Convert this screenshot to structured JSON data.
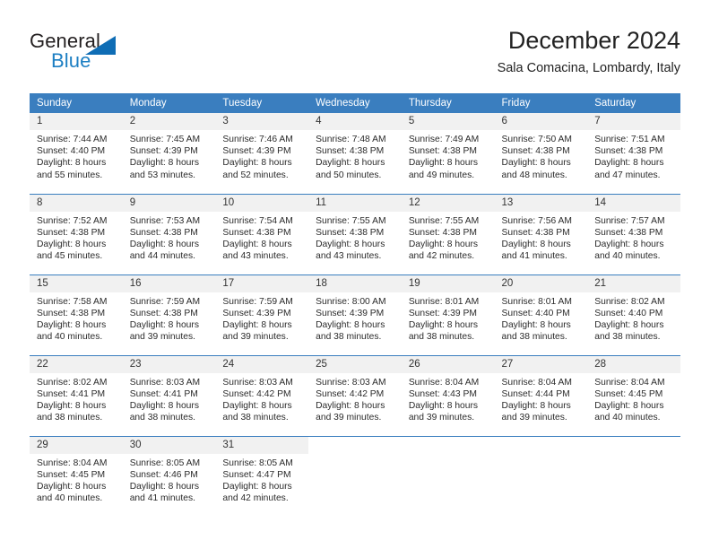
{
  "brand": {
    "name_part1": "General",
    "name_part2": "Blue",
    "triangle_color": "#0f6db5",
    "blue_text_color": "#1d7fc3"
  },
  "header": {
    "title": "December 2024",
    "subtitle": "Sala Comacina, Lombardy, Italy"
  },
  "theme": {
    "header_bg": "#3a7ebf",
    "daynum_bg": "#f1f1f1",
    "grid_line": "#3a7ebf",
    "text": "#222222"
  },
  "calendar": {
    "weekday_headers": [
      "Sunday",
      "Monday",
      "Tuesday",
      "Wednesday",
      "Thursday",
      "Friday",
      "Saturday"
    ],
    "weeks": [
      [
        {
          "day": "1",
          "sunrise": "Sunrise: 7:44 AM",
          "sunset": "Sunset: 4:40 PM",
          "daylight_line1": "Daylight: 8 hours",
          "daylight_line2": "and 55 minutes."
        },
        {
          "day": "2",
          "sunrise": "Sunrise: 7:45 AM",
          "sunset": "Sunset: 4:39 PM",
          "daylight_line1": "Daylight: 8 hours",
          "daylight_line2": "and 53 minutes."
        },
        {
          "day": "3",
          "sunrise": "Sunrise: 7:46 AM",
          "sunset": "Sunset: 4:39 PM",
          "daylight_line1": "Daylight: 8 hours",
          "daylight_line2": "and 52 minutes."
        },
        {
          "day": "4",
          "sunrise": "Sunrise: 7:48 AM",
          "sunset": "Sunset: 4:38 PM",
          "daylight_line1": "Daylight: 8 hours",
          "daylight_line2": "and 50 minutes."
        },
        {
          "day": "5",
          "sunrise": "Sunrise: 7:49 AM",
          "sunset": "Sunset: 4:38 PM",
          "daylight_line1": "Daylight: 8 hours",
          "daylight_line2": "and 49 minutes."
        },
        {
          "day": "6",
          "sunrise": "Sunrise: 7:50 AM",
          "sunset": "Sunset: 4:38 PM",
          "daylight_line1": "Daylight: 8 hours",
          "daylight_line2": "and 48 minutes."
        },
        {
          "day": "7",
          "sunrise": "Sunrise: 7:51 AM",
          "sunset": "Sunset: 4:38 PM",
          "daylight_line1": "Daylight: 8 hours",
          "daylight_line2": "and 47 minutes."
        }
      ],
      [
        {
          "day": "8",
          "sunrise": "Sunrise: 7:52 AM",
          "sunset": "Sunset: 4:38 PM",
          "daylight_line1": "Daylight: 8 hours",
          "daylight_line2": "and 45 minutes."
        },
        {
          "day": "9",
          "sunrise": "Sunrise: 7:53 AM",
          "sunset": "Sunset: 4:38 PM",
          "daylight_line1": "Daylight: 8 hours",
          "daylight_line2": "and 44 minutes."
        },
        {
          "day": "10",
          "sunrise": "Sunrise: 7:54 AM",
          "sunset": "Sunset: 4:38 PM",
          "daylight_line1": "Daylight: 8 hours",
          "daylight_line2": "and 43 minutes."
        },
        {
          "day": "11",
          "sunrise": "Sunrise: 7:55 AM",
          "sunset": "Sunset: 4:38 PM",
          "daylight_line1": "Daylight: 8 hours",
          "daylight_line2": "and 43 minutes."
        },
        {
          "day": "12",
          "sunrise": "Sunrise: 7:55 AM",
          "sunset": "Sunset: 4:38 PM",
          "daylight_line1": "Daylight: 8 hours",
          "daylight_line2": "and 42 minutes."
        },
        {
          "day": "13",
          "sunrise": "Sunrise: 7:56 AM",
          "sunset": "Sunset: 4:38 PM",
          "daylight_line1": "Daylight: 8 hours",
          "daylight_line2": "and 41 minutes."
        },
        {
          "day": "14",
          "sunrise": "Sunrise: 7:57 AM",
          "sunset": "Sunset: 4:38 PM",
          "daylight_line1": "Daylight: 8 hours",
          "daylight_line2": "and 40 minutes."
        }
      ],
      [
        {
          "day": "15",
          "sunrise": "Sunrise: 7:58 AM",
          "sunset": "Sunset: 4:38 PM",
          "daylight_line1": "Daylight: 8 hours",
          "daylight_line2": "and 40 minutes."
        },
        {
          "day": "16",
          "sunrise": "Sunrise: 7:59 AM",
          "sunset": "Sunset: 4:38 PM",
          "daylight_line1": "Daylight: 8 hours",
          "daylight_line2": "and 39 minutes."
        },
        {
          "day": "17",
          "sunrise": "Sunrise: 7:59 AM",
          "sunset": "Sunset: 4:39 PM",
          "daylight_line1": "Daylight: 8 hours",
          "daylight_line2": "and 39 minutes."
        },
        {
          "day": "18",
          "sunrise": "Sunrise: 8:00 AM",
          "sunset": "Sunset: 4:39 PM",
          "daylight_line1": "Daylight: 8 hours",
          "daylight_line2": "and 38 minutes."
        },
        {
          "day": "19",
          "sunrise": "Sunrise: 8:01 AM",
          "sunset": "Sunset: 4:39 PM",
          "daylight_line1": "Daylight: 8 hours",
          "daylight_line2": "and 38 minutes."
        },
        {
          "day": "20",
          "sunrise": "Sunrise: 8:01 AM",
          "sunset": "Sunset: 4:40 PM",
          "daylight_line1": "Daylight: 8 hours",
          "daylight_line2": "and 38 minutes."
        },
        {
          "day": "21",
          "sunrise": "Sunrise: 8:02 AM",
          "sunset": "Sunset: 4:40 PM",
          "daylight_line1": "Daylight: 8 hours",
          "daylight_line2": "and 38 minutes."
        }
      ],
      [
        {
          "day": "22",
          "sunrise": "Sunrise: 8:02 AM",
          "sunset": "Sunset: 4:41 PM",
          "daylight_line1": "Daylight: 8 hours",
          "daylight_line2": "and 38 minutes."
        },
        {
          "day": "23",
          "sunrise": "Sunrise: 8:03 AM",
          "sunset": "Sunset: 4:41 PM",
          "daylight_line1": "Daylight: 8 hours",
          "daylight_line2": "and 38 minutes."
        },
        {
          "day": "24",
          "sunrise": "Sunrise: 8:03 AM",
          "sunset": "Sunset: 4:42 PM",
          "daylight_line1": "Daylight: 8 hours",
          "daylight_line2": "and 38 minutes."
        },
        {
          "day": "25",
          "sunrise": "Sunrise: 8:03 AM",
          "sunset": "Sunset: 4:42 PM",
          "daylight_line1": "Daylight: 8 hours",
          "daylight_line2": "and 39 minutes."
        },
        {
          "day": "26",
          "sunrise": "Sunrise: 8:04 AM",
          "sunset": "Sunset: 4:43 PM",
          "daylight_line1": "Daylight: 8 hours",
          "daylight_line2": "and 39 minutes."
        },
        {
          "day": "27",
          "sunrise": "Sunrise: 8:04 AM",
          "sunset": "Sunset: 4:44 PM",
          "daylight_line1": "Daylight: 8 hours",
          "daylight_line2": "and 39 minutes."
        },
        {
          "day": "28",
          "sunrise": "Sunrise: 8:04 AM",
          "sunset": "Sunset: 4:45 PM",
          "daylight_line1": "Daylight: 8 hours",
          "daylight_line2": "and 40 minutes."
        }
      ],
      [
        {
          "day": "29",
          "sunrise": "Sunrise: 8:04 AM",
          "sunset": "Sunset: 4:45 PM",
          "daylight_line1": "Daylight: 8 hours",
          "daylight_line2": "and 40 minutes."
        },
        {
          "day": "30",
          "sunrise": "Sunrise: 8:05 AM",
          "sunset": "Sunset: 4:46 PM",
          "daylight_line1": "Daylight: 8 hours",
          "daylight_line2": "and 41 minutes."
        },
        {
          "day": "31",
          "sunrise": "Sunrise: 8:05 AM",
          "sunset": "Sunset: 4:47 PM",
          "daylight_line1": "Daylight: 8 hours",
          "daylight_line2": "and 42 minutes."
        },
        {
          "day": "",
          "sunrise": "",
          "sunset": "",
          "daylight_line1": "",
          "daylight_line2": ""
        },
        {
          "day": "",
          "sunrise": "",
          "sunset": "",
          "daylight_line1": "",
          "daylight_line2": ""
        },
        {
          "day": "",
          "sunrise": "",
          "sunset": "",
          "daylight_line1": "",
          "daylight_line2": ""
        },
        {
          "day": "",
          "sunrise": "",
          "sunset": "",
          "daylight_line1": "",
          "daylight_line2": ""
        }
      ]
    ]
  }
}
